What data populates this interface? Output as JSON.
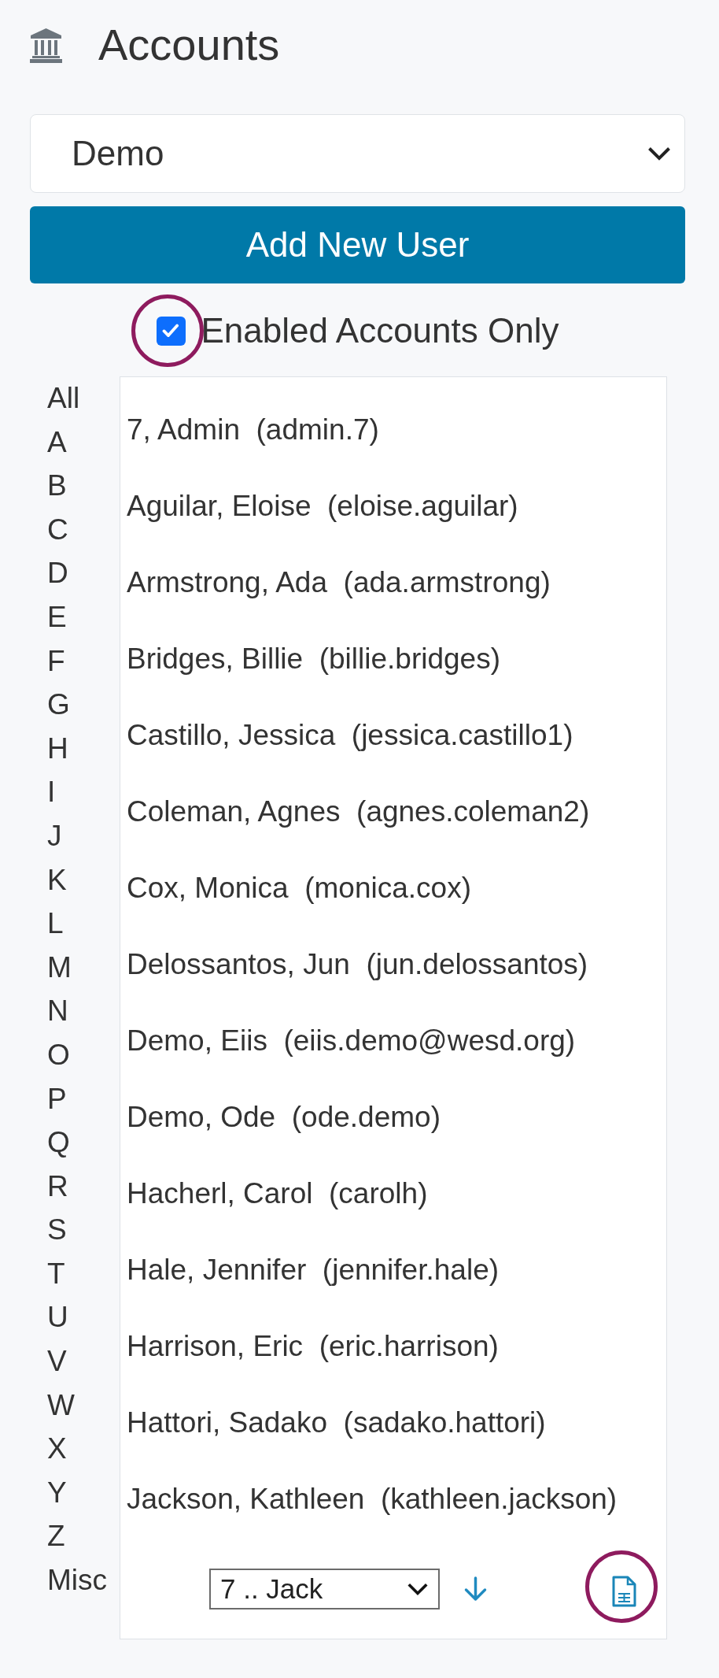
{
  "header": {
    "title": "Accounts"
  },
  "district_select": {
    "value": "Demo"
  },
  "add_button": {
    "label": "Add New User"
  },
  "enabled_only": {
    "label": "Enabled Accounts Only",
    "checked": true,
    "highlighted": true
  },
  "letters": [
    "All",
    "A",
    "B",
    "C",
    "D",
    "E",
    "F",
    "G",
    "H",
    "I",
    "J",
    "K",
    "L",
    "M",
    "N",
    "O",
    "P",
    "Q",
    "R",
    "S",
    "T",
    "U",
    "V",
    "W",
    "X",
    "Y",
    "Z",
    "Misc"
  ],
  "users": [
    "7, Admin  (admin.7)",
    "Aguilar, Eloise  (eloise.aguilar)",
    "Armstrong, Ada  (ada.armstrong)",
    "Bridges, Billie  (billie.bridges)",
    "Castillo, Jessica  (jessica.castillo1)",
    "Coleman, Agnes  (agnes.coleman2)",
    "Cox, Monica  (monica.cox)",
    "Delossantos, Jun  (jun.delossantos)",
    "Demo, Eiis  (eiis.demo@wesd.org)",
    "Demo, Ode  (ode.demo)",
    "Hacherl, Carol  (carolh)",
    "Hale, Jennifer  (jennifer.hale)",
    "Harrison, Eric  (eric.harrison)",
    "Hattori, Sadako  (sadako.hattori)",
    "Jackson, Kathleen  (kathleen.jackson)"
  ],
  "footer": {
    "range_select": {
      "value": "7 .. Jack"
    },
    "export": {
      "highlighted": true
    }
  }
}
